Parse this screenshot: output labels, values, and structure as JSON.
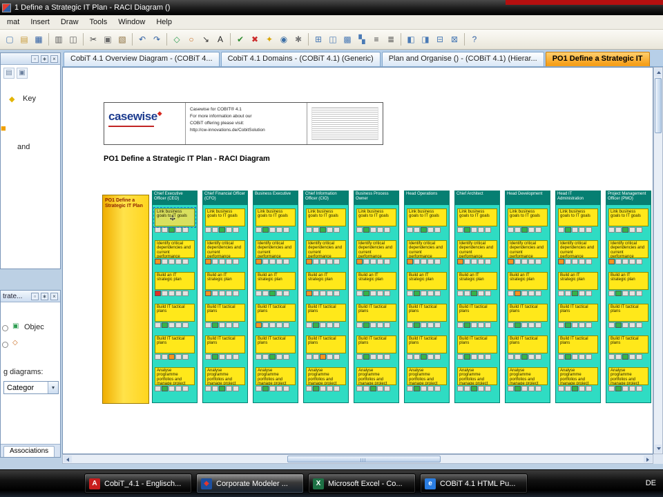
{
  "titlebar": {
    "title": "1 Define a Strategic IT Plan - RACI Diagram ()"
  },
  "menubar": {
    "items": [
      "mat",
      "Insert",
      "Draw",
      "Tools",
      "Window",
      "Help"
    ]
  },
  "chrome": {
    "float_glyph": "▫",
    "pin_glyph": "∗",
    "close_glyph": "×",
    "dropdown_arrow_glyph": "▾",
    "move_h_glyph": "↔",
    "move_v_glyph": "↕"
  },
  "toolbar": {
    "icons": [
      {
        "name": "new-icon",
        "glyph": "▢",
        "color": "#4a7ab5"
      },
      {
        "name": "open-icon",
        "glyph": "▤",
        "color": "#c79a3a"
      },
      {
        "name": "save-icon",
        "glyph": "▦",
        "color": "#2f5fa3"
      },
      {
        "sep": true
      },
      {
        "name": "print-icon",
        "glyph": "▥",
        "color": "#5a5a5a"
      },
      {
        "name": "print-preview-icon",
        "glyph": "◫",
        "color": "#5a5a5a"
      },
      {
        "sep": true
      },
      {
        "name": "cut-icon",
        "glyph": "✂",
        "color": "#444444"
      },
      {
        "name": "copy-icon",
        "glyph": "▣",
        "color": "#6a6a6a"
      },
      {
        "name": "paste-icon",
        "glyph": "▧",
        "color": "#8a6d3b"
      },
      {
        "sep": true
      },
      {
        "name": "undo-icon",
        "glyph": "↶",
        "color": "#2f5fa3"
      },
      {
        "name": "redo-icon",
        "glyph": "↷",
        "color": "#2f5fa3"
      },
      {
        "sep": true
      },
      {
        "name": "shape-tool-icon",
        "glyph": "◇",
        "color": "#2e9e52"
      },
      {
        "name": "ellipse-tool-icon",
        "glyph": "○",
        "color": "#c96a1e"
      },
      {
        "name": "connector-tool-icon",
        "glyph": "↘",
        "color": "#333333"
      },
      {
        "name": "text-tool-icon",
        "glyph": "A",
        "color": "#222222"
      },
      {
        "sep": true
      },
      {
        "name": "spellcheck-icon",
        "glyph": "✔",
        "color": "#2e8b2e"
      },
      {
        "name": "delete-icon",
        "glyph": "✖",
        "color": "#cc2b2b"
      },
      {
        "name": "favorite-icon",
        "glyph": "✦",
        "color": "#d9a400"
      },
      {
        "name": "zoom-icon",
        "glyph": "◉",
        "color": "#3a6ea5"
      },
      {
        "name": "settings-gear-icon",
        "glyph": "✱",
        "color": "#777777"
      },
      {
        "sep": true
      },
      {
        "name": "grid-icon",
        "glyph": "⊞",
        "color": "#4a7ab5"
      },
      {
        "name": "layout-icon",
        "glyph": "◫",
        "color": "#4a7ab5"
      },
      {
        "name": "cascade-windows-icon",
        "glyph": "▩",
        "color": "#4a7ab5"
      },
      {
        "name": "tile-windows-icon",
        "glyph": "▚",
        "color": "#4a7ab5"
      },
      {
        "name": "align-icon",
        "glyph": "≡",
        "color": "#444444"
      },
      {
        "name": "layers-icon",
        "glyph": "≣",
        "color": "#444444"
      },
      {
        "sep": true
      },
      {
        "name": "bring-front-icon",
        "glyph": "◧",
        "color": "#4a7ab5"
      },
      {
        "name": "send-back-icon",
        "glyph": "◨",
        "color": "#4a7ab5"
      },
      {
        "name": "group-icon",
        "glyph": "⊟",
        "color": "#4a7ab5"
      },
      {
        "name": "ungroup-icon",
        "glyph": "⊠",
        "color": "#4a7ab5"
      },
      {
        "sep": true
      },
      {
        "name": "help-icon",
        "glyph": "?",
        "color": "#2f5fa3"
      }
    ]
  },
  "left_panels": {
    "panel1": {
      "tool_icon_1_glyph": "▤",
      "tool_icon_2_glyph": "▣",
      "key_icon_glyph": "◆",
      "label_key": "Key",
      "swatch_glyph": "■",
      "label_and": "and"
    },
    "panel2": {
      "title": "trate...",
      "icon1_glyph": "▣",
      "object_label": "Objec",
      "icon2_glyph": "◇",
      "diagrams_label": "g diagrams:",
      "category_value": "Categor",
      "tab_label": "Associations"
    }
  },
  "tabs": [
    {
      "label": "CobiT 4.1 Overview Diagram - (COBiT 4...",
      "active": false
    },
    {
      "label": "CobiT 4.1 Domains - (COBiT 4.1) (Generic)",
      "active": false
    },
    {
      "label": "Plan and Organise () - (COBiT 4.1) (Hierar...",
      "active": false
    },
    {
      "label": "PO1 Define a Strategic IT",
      "active": true
    }
  ],
  "canvas": {
    "heading": "PO1 Define a Strategic IT Plan - RACI Diagram",
    "logo": {
      "brand": "casewise",
      "line1": "Casewise for COBIT® 4.1",
      "line2": "For more information about our",
      "line3": "COBiT offering please visit:",
      "link": "http://cw-innovations.de/CobitSolution"
    },
    "process_box": "PO1 Define a Strategic IT Plan"
  },
  "colors": {
    "active_tab": "#F6A01B",
    "column_teal": "#2FDCC3",
    "column_header": "#067F72",
    "activity_yellow": "#FFE81A",
    "process_yellow": "#FFD51E",
    "mark_gray": "#E3E3E0",
    "mark_green": "#33B44A",
    "mark_orange": "#F79420",
    "mark_red": "#E03128"
  },
  "diagram": {
    "activities": [
      "Link business goals to IT goals",
      "Identify critical dependencies and current performance",
      "Build an IT strategic plan",
      "Build IT tactical plans",
      "Build IT tactical plans",
      "Analyse programme portfolios and manage project and service portfolios"
    ],
    "columns": [
      {
        "title": "Chief Executive Officer (CEO)",
        "marks": [
          "ggGgg",
          "Ogggg",
          "Rgggg",
          "gGggg",
          "ggOgg",
          "gGggg"
        ]
      },
      {
        "title": "Chief Financial Officer (CFO)",
        "marks": [
          "ggGgg",
          "Ogggg",
          "Ogggg",
          "gGggg",
          "gGggg",
          "ggGgg"
        ]
      },
      {
        "title": "Business Executive",
        "marks": [
          "gGggg",
          "Ogggg",
          "ggGgg",
          "Ogggg",
          "ggGgg",
          "gGggg"
        ]
      },
      {
        "title": "Chief Information Officer (CIO)",
        "marks": [
          "ggGgg",
          "Ogggg",
          "Ogggg",
          "gGggg",
          "ggOgg",
          "gGggg"
        ]
      },
      {
        "title": "Business Process Owner",
        "marks": [
          "gGggg",
          "Ogggg",
          "gGggg",
          "gGggg",
          "gGggg",
          "ggGgg"
        ]
      },
      {
        "title": "Head Operations",
        "marks": [
          "ggGgg",
          "Ogggg",
          "gGggg",
          "gGggg",
          "ggGgg",
          "gGggg"
        ]
      },
      {
        "title": "Chief Architect",
        "marks": [
          "gGggg",
          "Ogggg",
          "ggGgg",
          "gGggg",
          "gGggg",
          "ggGgg"
        ]
      },
      {
        "title": "Head Development",
        "marks": [
          "ggGgg",
          "Ogggg",
          "gOggg",
          "gGggg",
          "ggGgg",
          "gGggg"
        ]
      },
      {
        "title": "Head IT Administration",
        "marks": [
          "gGggg",
          "Ogggg",
          "ggGgg",
          "gGggg",
          "gGggg",
          "ggGgg"
        ]
      },
      {
        "title": "Project Management Officer (PMO)",
        "marks": [
          "ggGgg",
          "Ogggg",
          "gGggg",
          "gGggg",
          "ggGgg",
          "gGggg"
        ]
      }
    ]
  },
  "taskbar": {
    "buttons": [
      {
        "label": "CobiT_4.1 - Englisch...",
        "icon_name": "pdf-icon",
        "icon_bg": "#c81e1e",
        "icon_glyph": "A",
        "icon_fg": "#ffffff",
        "active": false
      },
      {
        "label": "Corporate Modeler ...",
        "icon_name": "corporate-modeler-icon",
        "icon_bg": "#1d4f9e",
        "icon_glyph": "◆",
        "icon_fg": "#e2372f",
        "active": true
      },
      {
        "label": "Microsoft Excel - Co...",
        "icon_name": "excel-icon",
        "icon_bg": "#1e7145",
        "icon_glyph": "X",
        "icon_fg": "#ffffff",
        "active": false
      },
      {
        "label": "COBiT 4.1 HTML Pu...",
        "icon_name": "internet-explorer-icon",
        "icon_bg": "#2a7de1",
        "icon_glyph": "e",
        "icon_fg": "#ffffff",
        "active": false
      }
    ],
    "language": "DE"
  }
}
